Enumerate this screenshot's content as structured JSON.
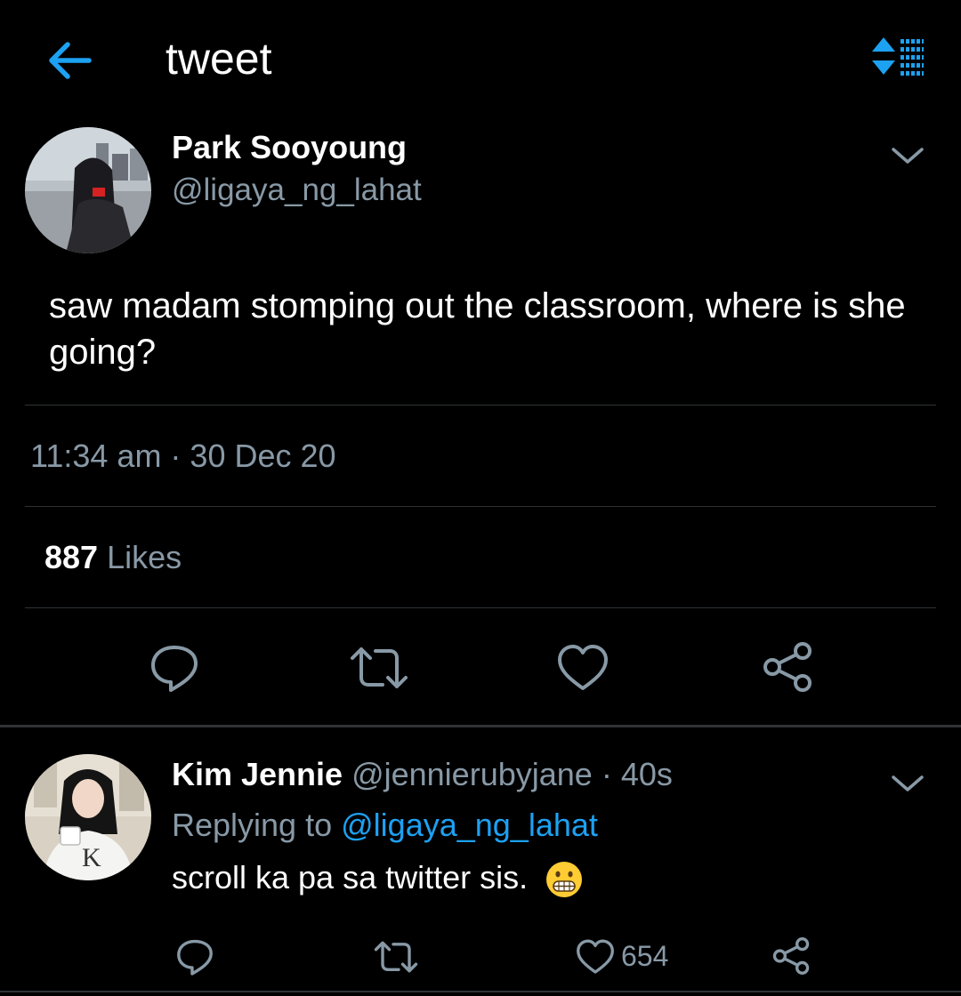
{
  "header": {
    "title": "tweet",
    "back_icon": "arrow-left-icon",
    "sort_icon": "sort-list-icon"
  },
  "main_tweet": {
    "author_name": "Park Sooyoung",
    "author_handle": "@ligaya_ng_lahat",
    "text": "saw madam stomping out the classroom, where is she going?",
    "timestamp": "11:34 am · 30 Dec 20",
    "likes_count": "887",
    "likes_label": "Likes",
    "actions": [
      "reply-icon",
      "retweet-icon",
      "heart-icon",
      "share-icon"
    ]
  },
  "reply": {
    "author_name": "Kim Jennie",
    "author_handle": "@jennierubyjane",
    "separator": "·",
    "time": "40s",
    "replying_label": "Replying to",
    "replying_handle": "@ligaya_ng_lahat",
    "text": "scroll ka pa sa twitter sis.",
    "emoji": "grimacing-face-emoji",
    "like_count": "654"
  },
  "colors": {
    "background": "#000000",
    "accent": "#1da1f2",
    "secondary_text": "#8899a6",
    "divider": "#2f3336"
  }
}
